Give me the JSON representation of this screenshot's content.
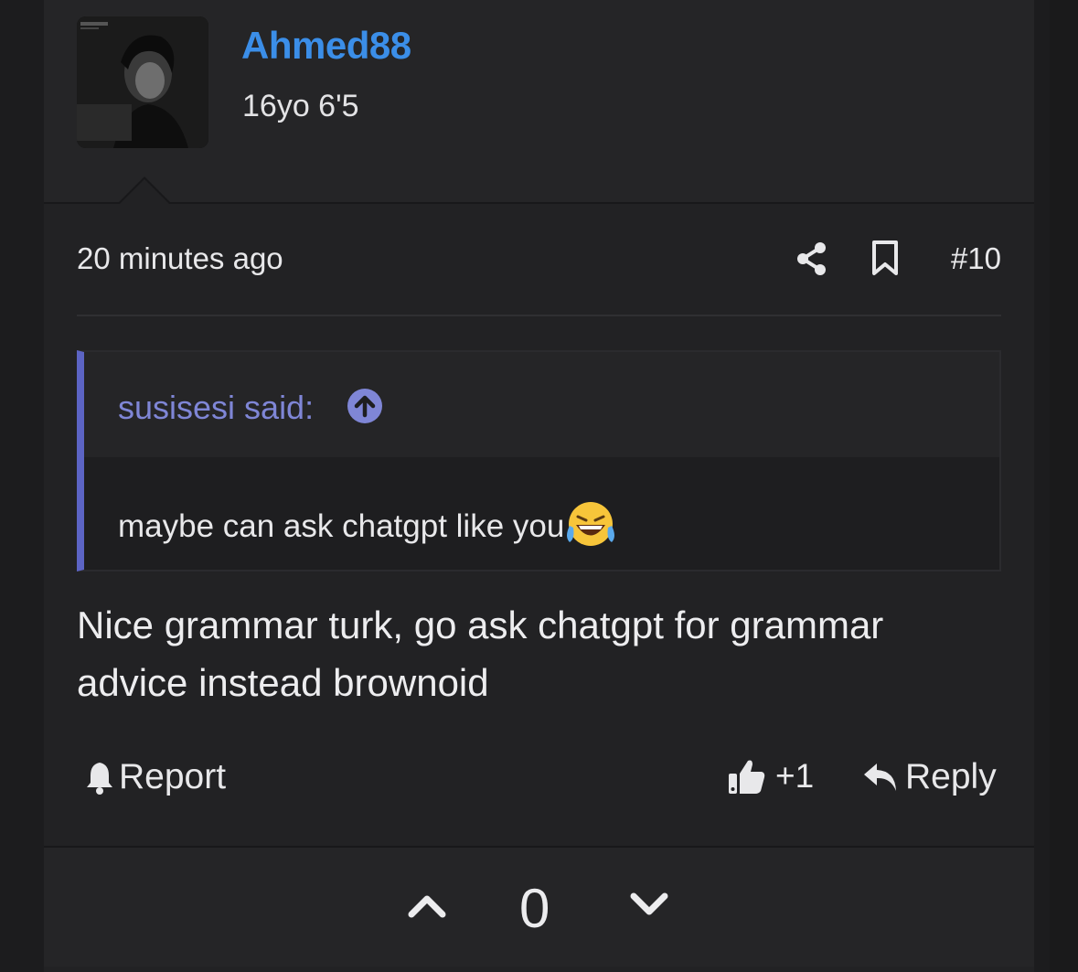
{
  "user": {
    "username": "Ahmed88",
    "title": "16yo 6'5"
  },
  "meta": {
    "timestamp": "20 minutes ago",
    "post_number": "#10"
  },
  "quote": {
    "author_label": "susisesi said:",
    "text": "maybe can ask chatgpt like you"
  },
  "message": {
    "text": "Nice grammar turk, go ask chatgpt for grammar advice instead brownoid"
  },
  "actions": {
    "report_label": "Report",
    "like_count": "+1",
    "reply_label": "Reply"
  },
  "vote": {
    "score": "0"
  },
  "colors": {
    "username": "#3b8ee8",
    "quote_accent": "#5c64c4",
    "background": "#222224"
  },
  "icons": [
    "share-icon",
    "bookmark-icon",
    "arrow-up-circle-icon",
    "laughing-tears-emoji",
    "bell-icon",
    "thumbs-up-icon",
    "reply-icon",
    "chevron-up-icon",
    "chevron-down-icon"
  ]
}
